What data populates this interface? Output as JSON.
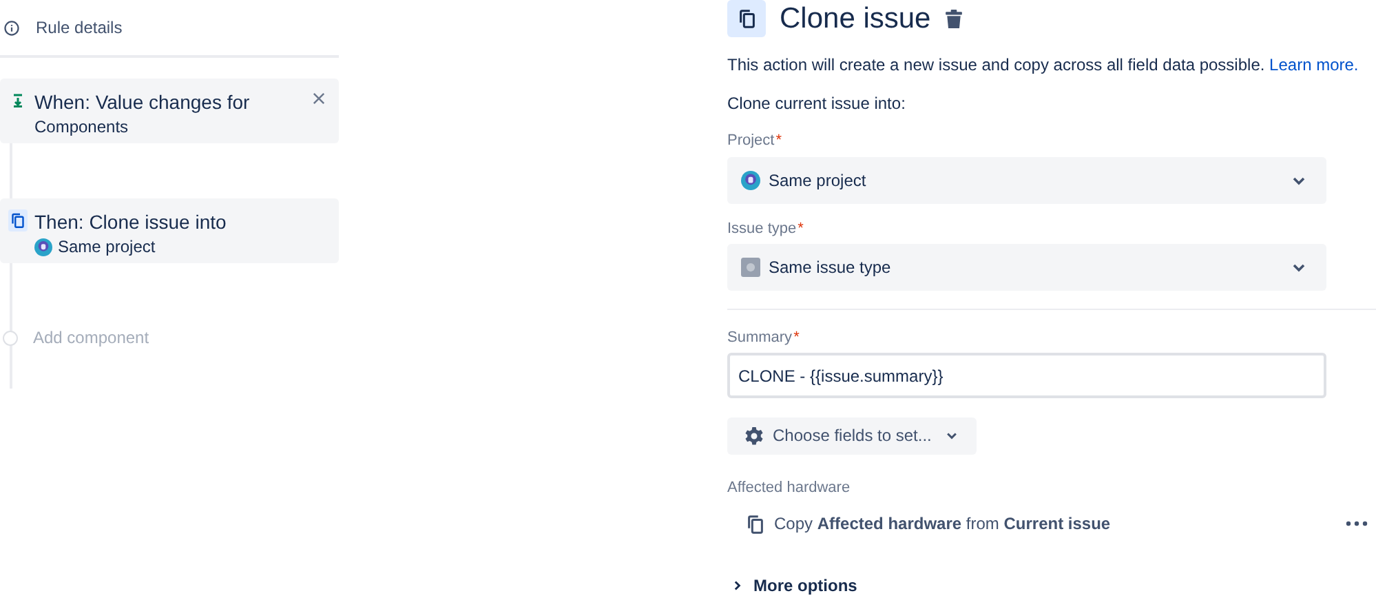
{
  "sidebar": {
    "rule_details": "Rule details",
    "components": [
      {
        "kind": "trigger",
        "title": "When: Value changes for",
        "subtitle": "Components",
        "selected": false
      },
      {
        "kind": "action",
        "title": "Then: Clone issue into",
        "subtitle": "Same project",
        "selected": true
      }
    ],
    "add_component": "Add component"
  },
  "panel": {
    "title": "Clone issue",
    "description": "This action will create a new issue and copy across all field data possible.",
    "learn_more": "Learn more.",
    "intro": "Clone current issue into:",
    "selects": [
      {
        "label": "Project",
        "required": "*",
        "value": "Same project",
        "kind": "project"
      },
      {
        "label": "Issue type",
        "required": "*",
        "value": "Same issue type",
        "kind": "issue-type"
      }
    ],
    "summary": {
      "label": "Summary",
      "required": "*",
      "value": "CLONE - {{issue.summary}}"
    },
    "choose_fields": "Choose fields to set...",
    "field_section": {
      "label": "Affected hardware",
      "text": "Copy **Affected hardware** from **Current issue**"
    },
    "more_options": "More options"
  }
}
